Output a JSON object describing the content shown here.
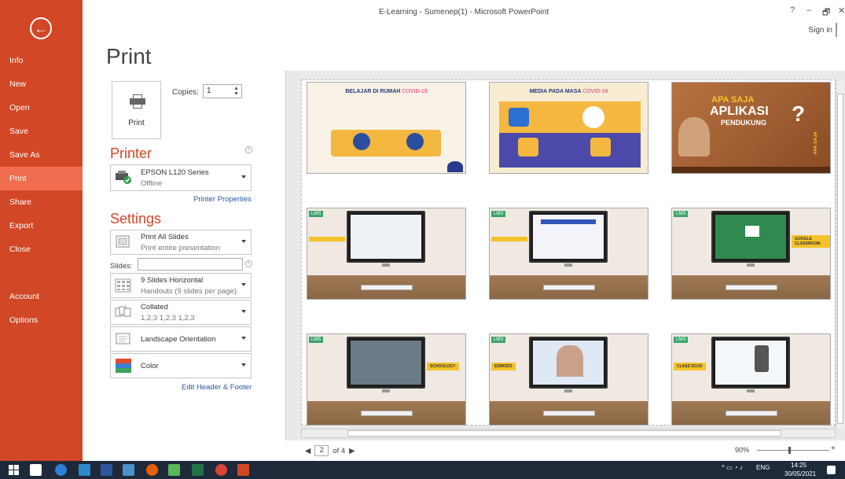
{
  "window": {
    "title": "E-Learning - Sumenep(1) - Microsoft PowerPoint",
    "help": "?",
    "minimize": "–",
    "restore": "🗗",
    "close": "✕",
    "sign_in": "Sign in"
  },
  "sidebar": {
    "back": "←",
    "items": [
      {
        "label": "Info"
      },
      {
        "label": "New"
      },
      {
        "label": "Open"
      },
      {
        "label": "Save"
      },
      {
        "label": "Save As"
      },
      {
        "label": "Print"
      },
      {
        "label": "Share"
      },
      {
        "label": "Export"
      },
      {
        "label": "Close"
      },
      {
        "label": "Account"
      },
      {
        "label": "Options"
      }
    ],
    "active": "Print",
    "accent": "#d24726"
  },
  "print_panel": {
    "title": "Print",
    "print_button": "Print",
    "copies_label": "Copies:",
    "copies_value": "1",
    "printer_heading": "Printer",
    "printer_name": "EPSON L120 Series",
    "printer_status": "Offline",
    "printer_properties": "Printer Properties",
    "settings_heading": "Settings",
    "slides_label": "Slides:",
    "slides_value": "",
    "settings": [
      {
        "line1": "Print All Slides",
        "line2": "Print entire presentation"
      },
      {
        "line1": "9 Slides Horizontal",
        "line2": "Handouts (9 slides per page)"
      },
      {
        "line1": "Collated",
        "line2": "1,2,3   1,2,3   1,2,3"
      },
      {
        "line1": "Landscape Orientation",
        "line2": ""
      },
      {
        "line1": "Color",
        "line2": ""
      }
    ],
    "edit_header_footer": "Edit Header & Footer"
  },
  "preview": {
    "slides": [
      {
        "kind": "covid",
        "title_a": "BELAJAR DI RUMAH ",
        "title_b": "COVID-19"
      },
      {
        "kind": "covid",
        "title_a": "MEDIA PADA MASA ",
        "title_b": "COVID-19"
      },
      {
        "kind": "apa",
        "line1": "APA SAJA",
        "line2": "APLIKASI",
        "line3": "PENDUKUNG",
        "mark": "?",
        "side": "APA SAJA"
      },
      {
        "kind": "lms",
        "tag": "LMS"
      },
      {
        "kind": "lms",
        "tag": "LMS"
      },
      {
        "kind": "lms",
        "tag": "LMS",
        "label": "GOOGLE CLASSROOM"
      },
      {
        "kind": "lms",
        "tag": "LMS",
        "label": "SCHOOLOGY"
      },
      {
        "kind": "lms",
        "tag": "LMS",
        "label": "EDMODO"
      },
      {
        "kind": "lms",
        "tag": "LMS",
        "label": "CLASS DOJO"
      }
    ],
    "page_current": "2",
    "page_total": "of 4",
    "zoom": "90%"
  },
  "taskbar": {
    "language": "ENG",
    "time": "14:25",
    "date": "30/05/2021"
  }
}
